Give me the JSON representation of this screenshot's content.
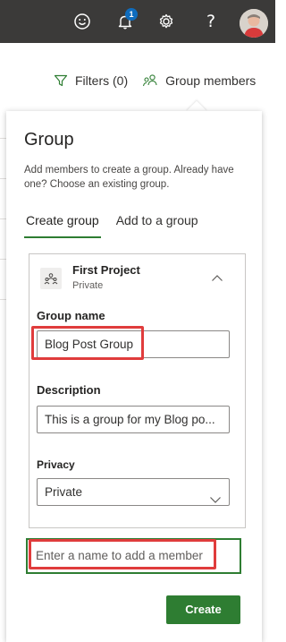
{
  "topbar": {
    "notification_count": "1",
    "icons": [
      "smiley-icon",
      "bell-icon",
      "gear-icon",
      "help-icon",
      "avatar"
    ],
    "background_color": "#3b3a39"
  },
  "toolbar": {
    "filters_label": "Filters (0)",
    "group_members_label": "Group members"
  },
  "panel": {
    "title": "Group",
    "description": "Add members to create a group. Already have one? Choose an existing group.",
    "tabs": [
      {
        "label": "Create group",
        "active": true
      },
      {
        "label": "Add to a group",
        "active": false
      }
    ],
    "project": {
      "name": "First Project",
      "privacy_label": "Private"
    },
    "group_name": {
      "label": "Group name",
      "value": "Blog Post Group"
    },
    "description_field": {
      "label": "Description",
      "value": "This is a group for my Blog po..."
    },
    "privacy": {
      "label": "Privacy",
      "selected": "Private"
    },
    "member_input": {
      "placeholder": "Enter a name to add a member"
    },
    "create_label": "Create"
  },
  "colors": {
    "accent": "#2e7d32",
    "highlight": "#e03c3c",
    "badge": "#0f6cbd"
  }
}
